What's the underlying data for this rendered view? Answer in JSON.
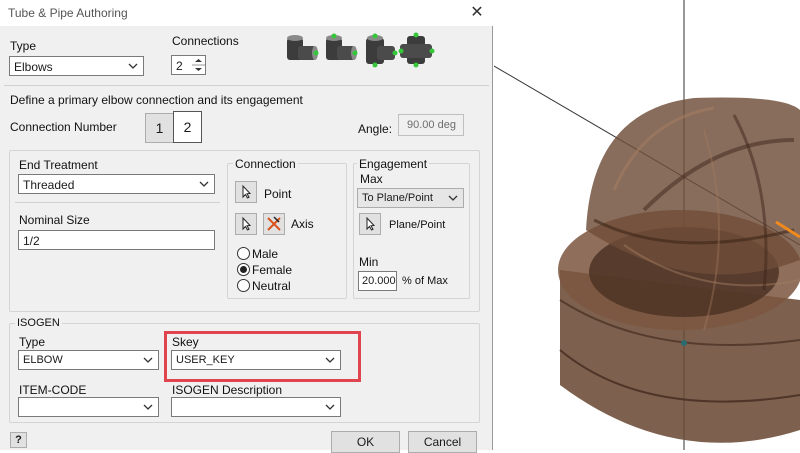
{
  "dialog": {
    "title": "Tube & Pipe Authoring",
    "close_glyph": "✕"
  },
  "top": {
    "type_label": "Type",
    "type_value": "Elbows",
    "connections_label": "Connections",
    "connections_value": "2",
    "thumbnails": [
      "elbow-2-connections",
      "elbow-2-connections-alt",
      "elbow-3-connections",
      "elbow-4-connections"
    ]
  },
  "primary": {
    "instruction": "Define a primary elbow connection and its engagement",
    "connection_number_label": "Connection Number",
    "connection_buttons": [
      "1",
      "2"
    ],
    "selected_connection": "2",
    "angle_label": "Angle:",
    "angle_value": "90.00 deg"
  },
  "end_treatment": {
    "label": "End Treatment",
    "value": "Threaded",
    "nominal_size_label": "Nominal Size",
    "nominal_size_value": "1/2"
  },
  "connection": {
    "label": "Connection",
    "point_label": "Point",
    "axis_label": "Axis",
    "radios": [
      {
        "label": "Male",
        "checked": false
      },
      {
        "label": "Female",
        "checked": true
      },
      {
        "label": "Neutral",
        "checked": false
      }
    ]
  },
  "engagement": {
    "label": "Engagement",
    "max_label": "Max",
    "max_value": "To Plane/Point",
    "plane_point_label": "Plane/Point",
    "min_label": "Min",
    "min_value": "20.000",
    "min_suffix": "% of Max"
  },
  "isogen": {
    "label": "ISOGEN",
    "type_label": "Type",
    "type_value": "ELBOW",
    "skey_label": "Skey",
    "skey_value": "USER_KEY",
    "item_code_label": "ITEM-CODE",
    "item_code_value": "",
    "description_label": "ISOGEN Description",
    "description_value": ""
  },
  "footer": {
    "help_glyph": "?",
    "ok_label": "OK",
    "cancel_label": "Cancel"
  },
  "colors": {
    "highlight": "#e0454f",
    "part_bronze": "#6b4a36",
    "axis_orange": "#f08a1c"
  }
}
